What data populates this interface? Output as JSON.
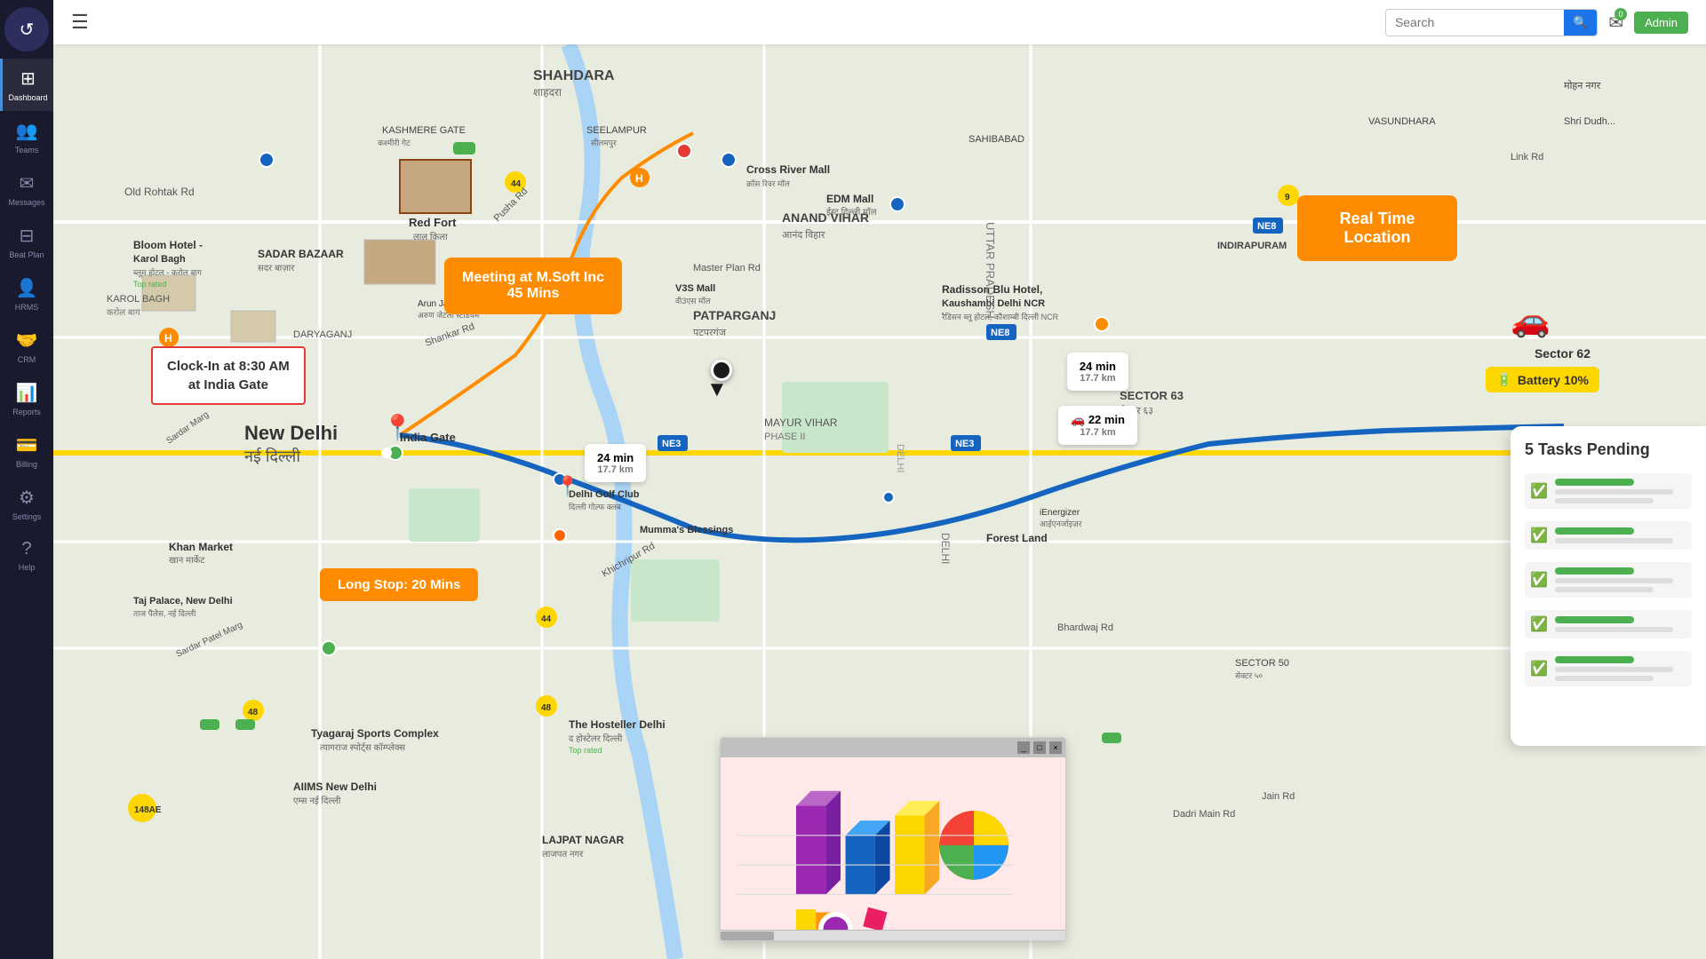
{
  "sidebar": {
    "logo_symbol": "↺",
    "items": [
      {
        "id": "dashboard",
        "label": "Dashboard",
        "icon": "⊞",
        "active": true
      },
      {
        "id": "teams",
        "label": "Teams",
        "icon": "👥",
        "active": false
      },
      {
        "id": "messages",
        "label": "Messages",
        "icon": "✉",
        "active": false
      },
      {
        "id": "beat-plan",
        "label": "Beat Plan",
        "icon": "⊟",
        "active": false
      },
      {
        "id": "hrms",
        "label": "HRMS",
        "icon": "👤",
        "active": false
      },
      {
        "id": "crm",
        "label": "CRM",
        "icon": "🤝",
        "active": false
      },
      {
        "id": "reports",
        "label": "Reports",
        "icon": "📊",
        "active": false
      },
      {
        "id": "billing",
        "label": "Billing",
        "icon": "💳",
        "active": false
      },
      {
        "id": "settings",
        "label": "Settings",
        "icon": "⚙",
        "active": false
      },
      {
        "id": "help",
        "label": "Help",
        "icon": "?",
        "active": false
      }
    ]
  },
  "topbar": {
    "menu_icon": "☰",
    "search_placeholder": "Search",
    "notification_count": "0",
    "admin_label": "Admin"
  },
  "map": {
    "real_time_location_title": "Real Time",
    "real_time_location_subtitle": "Location",
    "meeting_line1": "Meeting at M.Soft Inc",
    "meeting_line2": "45 Mins",
    "clock_in_line1": "Clock-In at 8:30 AM",
    "clock_in_line2": "at India Gate",
    "long_stop_label": "Long Stop: 20 Mins",
    "india_gate_label": "India Gate",
    "new_delhi_label": "New Delhi",
    "new_delhi_hindi": "नई दिल्ली",
    "time_box1_time": "24 min",
    "time_box1_dist": "17.7 km",
    "time_box2_time": "🚗 22 min",
    "time_box2_dist": "17.7 km",
    "time_box3_time": "24 min",
    "time_box3_dist": "17.7 km",
    "battery_label": "Battery 10%",
    "sector_label": "Sector 62"
  },
  "tasks": {
    "title": "5 Tasks Pending",
    "items": [
      {
        "id": 1
      },
      {
        "id": 2
      },
      {
        "id": 3
      },
      {
        "id": 4
      },
      {
        "id": 5
      }
    ]
  },
  "chart": {
    "title": "",
    "minimize_label": "_",
    "restore_label": "□",
    "close_label": "×"
  }
}
